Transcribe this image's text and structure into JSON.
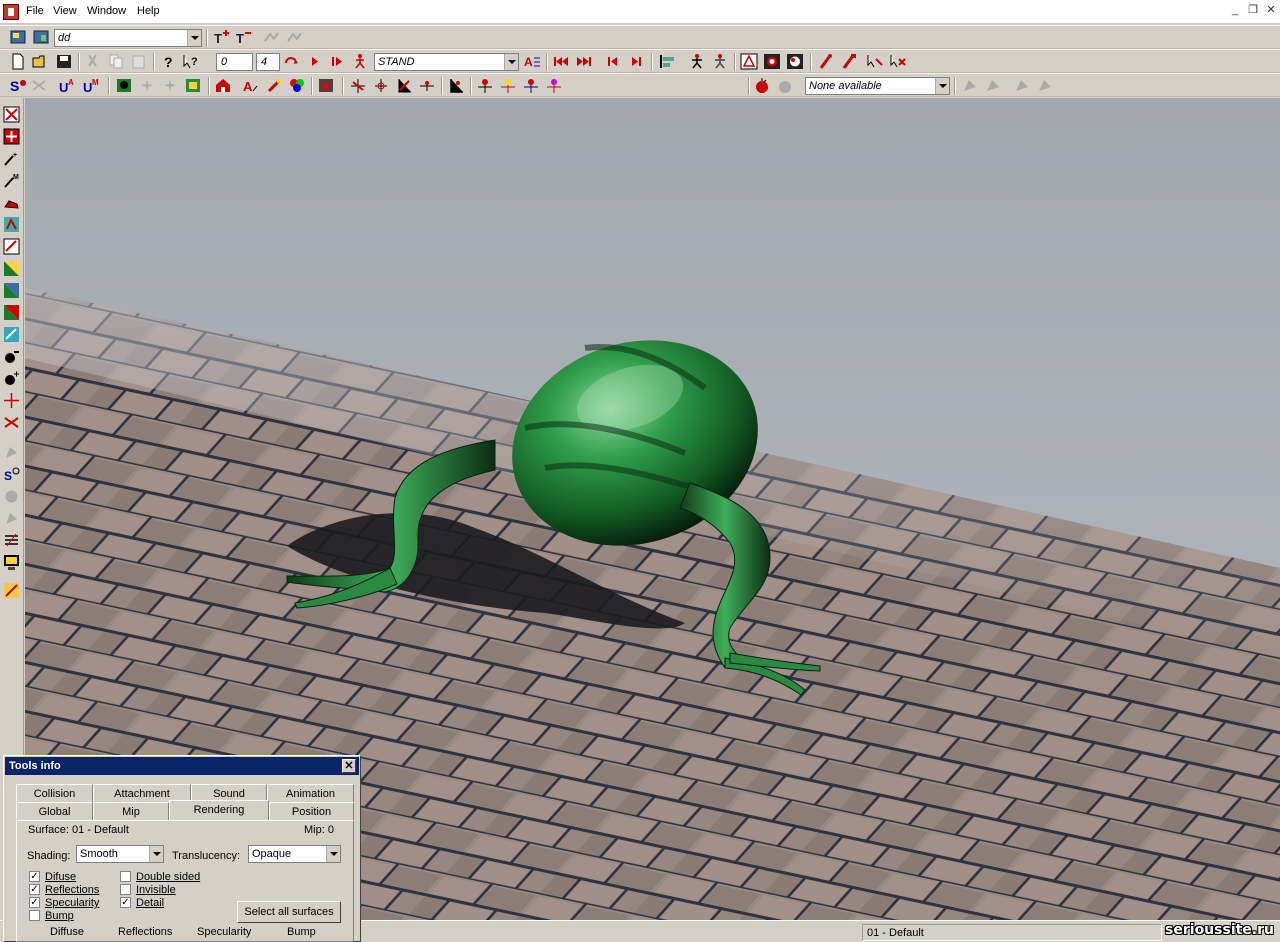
{
  "menu": {
    "items": [
      "File",
      "View",
      "Window",
      "Help"
    ]
  },
  "toolbar1": {
    "combo_value": "dd"
  },
  "toolbar2": {
    "frame_start": "0",
    "frame_end": "4",
    "animation_combo": "STAND"
  },
  "toolbar3": {
    "light_combo": "None available"
  },
  "tools_info": {
    "title": "Tools info",
    "close": "✕",
    "tabs_row1": [
      "Collision",
      "Attachment",
      "Sound",
      "Animation"
    ],
    "tabs_row2": [
      "Global",
      "Mip",
      "Rendering",
      "Position"
    ],
    "active_tab": "Rendering",
    "surface_label": "Surface: 01 - Default",
    "mip_label": "Mip: 0",
    "shading_label": "Shading:",
    "shading_value": "Smooth",
    "translucency_label": "Translucency:",
    "translucency_value": "Opaque",
    "options_left": [
      {
        "label": "Difuse",
        "checked": true
      },
      {
        "label": "Reflections",
        "checked": true
      },
      {
        "label": "Specularity",
        "checked": true
      },
      {
        "label": "Bump",
        "checked": false
      }
    ],
    "options_right": [
      {
        "label": "Double sided",
        "checked": false
      },
      {
        "label": "Invisible",
        "checked": false
      },
      {
        "label": "Detail",
        "checked": true
      }
    ],
    "select_all_button": "Select all surfaces",
    "bottom_labels": [
      "Diffuse",
      "Reflections",
      "Specularity",
      "Bump"
    ]
  },
  "status": {
    "surface": "01 - Default"
  },
  "watermark": "serioussite.ru",
  "colors": {
    "title_bar": "#0a246a",
    "model_green": "#2f9e4a",
    "sky": "#a7abb3",
    "floor": "#8c7f78"
  }
}
